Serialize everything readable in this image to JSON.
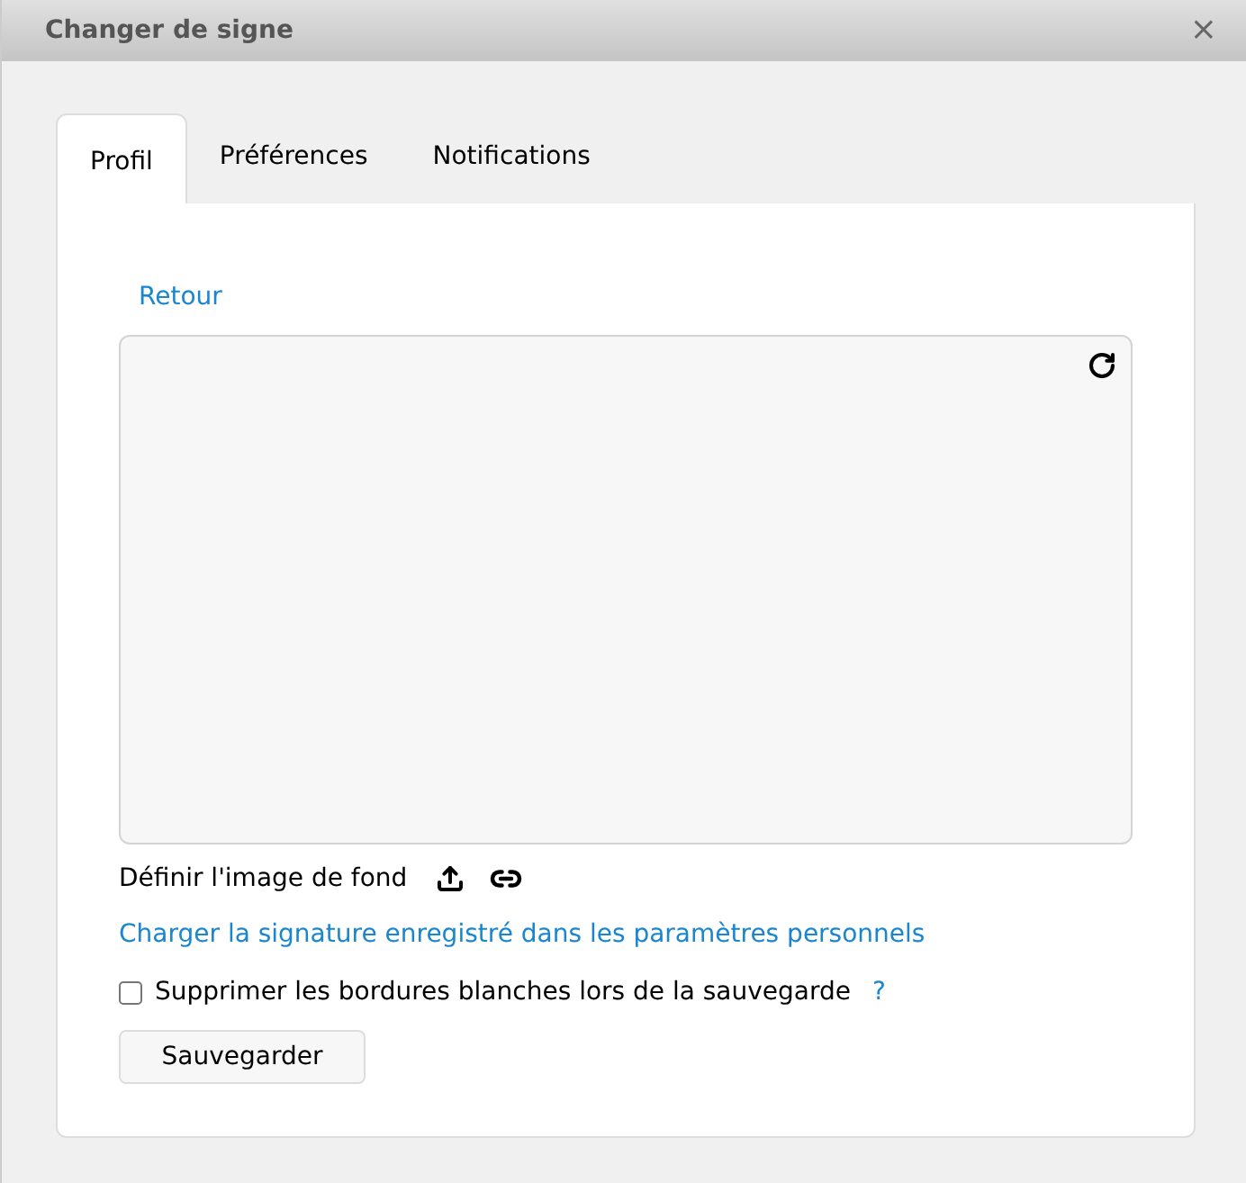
{
  "window": {
    "title": "Changer de signe",
    "close": "×"
  },
  "tabs": [
    {
      "label": "Profil",
      "selected": true
    },
    {
      "label": "Préférences",
      "selected": false
    },
    {
      "label": "Notifications",
      "selected": false
    }
  ],
  "back_link": "Retour",
  "background_label": "Définir l'image de fond",
  "load_link": "Charger la signature enregistré dans les paramètres personnels",
  "trim_option": {
    "label": "Supprimer les bordures blanches lors de la sauvegarde",
    "checked": false,
    "help": "?"
  },
  "save_button": "Sauvegarder"
}
